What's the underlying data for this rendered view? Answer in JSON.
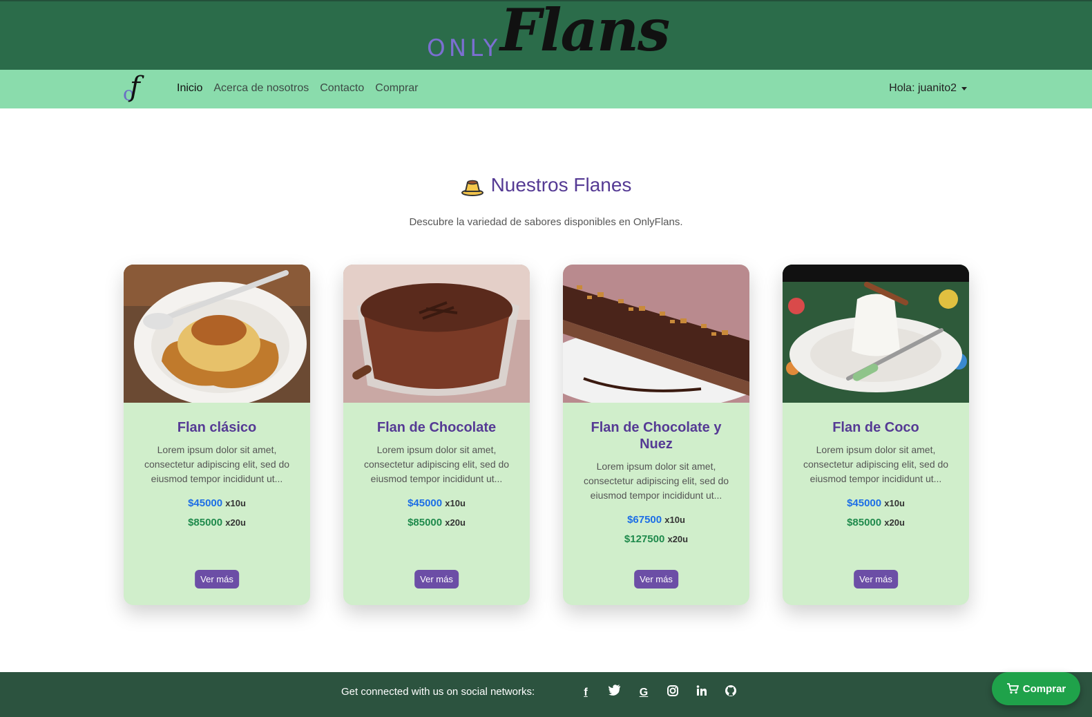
{
  "header": {
    "logo_only": "ONLY",
    "logo_flans": "Flans"
  },
  "navbar": {
    "brand_o": "o",
    "brand_f": "f",
    "links": [
      "Inicio",
      "Acerca de nosotros",
      "Contacto",
      "Comprar"
    ],
    "user_greeting": "Hola: juanito2"
  },
  "section": {
    "title": "Nuestros Flanes",
    "subtitle": "Descubre la variedad de sabores disponibles en OnlyFlans."
  },
  "cards": [
    {
      "title": "Flan clásico",
      "desc": "Lorem ipsum dolor sit amet, consectetur adipiscing elit, sed do eiusmod tempor incididunt ut...",
      "price1": "$45000",
      "qty1": "x10u",
      "price2": "$85000",
      "qty2": "x20u",
      "button": "Ver más"
    },
    {
      "title": "Flan de Chocolate",
      "desc": "Lorem ipsum dolor sit amet, consectetur adipiscing elit, sed do eiusmod tempor incididunt ut...",
      "price1": "$45000",
      "qty1": "x10u",
      "price2": "$85000",
      "qty2": "x20u",
      "button": "Ver más"
    },
    {
      "title": "Flan de Chocolate y Nuez",
      "desc": "Lorem ipsum dolor sit amet, consectetur adipiscing elit, sed do eiusmod tempor incididunt ut...",
      "price1": "$67500",
      "qty1": "x10u",
      "price2": "$127500",
      "qty2": "x20u",
      "button": "Ver más"
    },
    {
      "title": "Flan de Coco",
      "desc": "Lorem ipsum dolor sit amet, consectetur adipiscing elit, sed do eiusmod tempor incididunt ut...",
      "price1": "$45000",
      "qty1": "x10u",
      "price2": "$85000",
      "qty2": "x20u",
      "button": "Ver más"
    }
  ],
  "footer": {
    "text": "Get connected with us on social networks:",
    "socials": [
      "facebook-icon",
      "twitter-icon",
      "google-icon",
      "instagram-icon",
      "linkedin-icon",
      "github-icon"
    ]
  },
  "fab": {
    "label": "Comprar"
  },
  "colors": {
    "banner": "#2b6c4a",
    "navbar": "#8adcac",
    "card_bg": "#d0eecb",
    "accent_purple": "#553a94",
    "button_purple": "#6c4ea6",
    "footer": "#2c533f",
    "fab_green": "#1fa24a"
  }
}
